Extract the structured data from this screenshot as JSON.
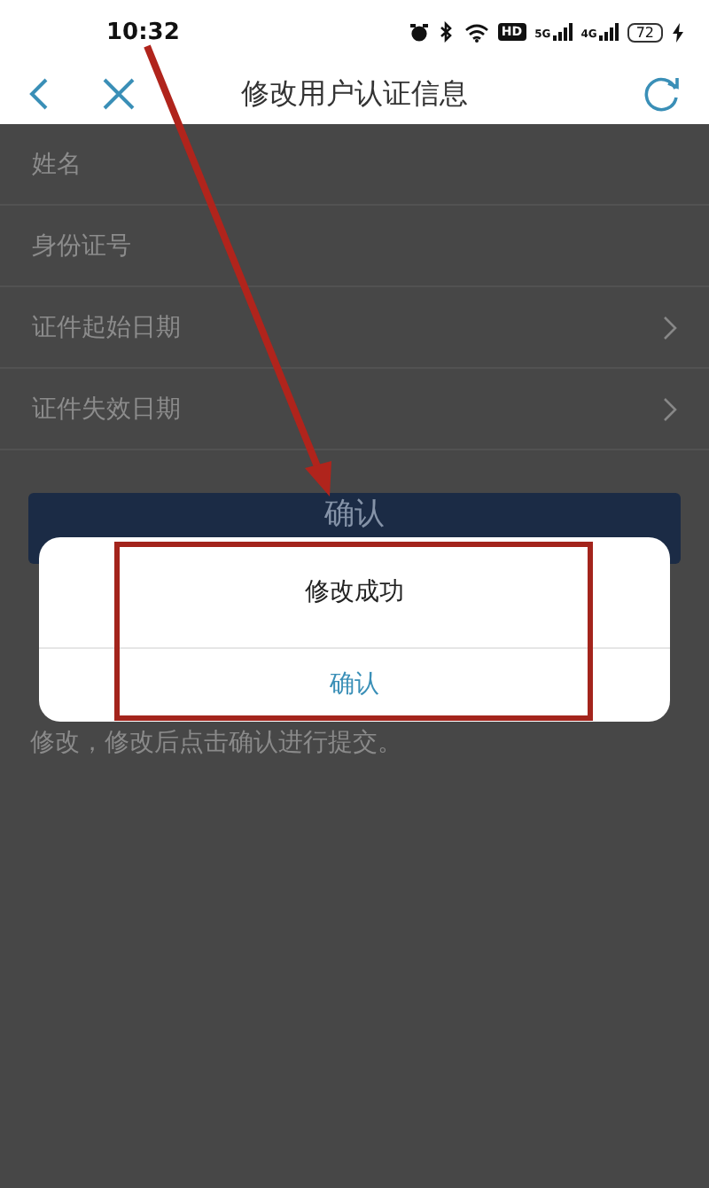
{
  "status_bar": {
    "time": "10:32",
    "hd": "HD",
    "signals": [
      "5G",
      "4G"
    ],
    "battery": "72",
    "charging": true
  },
  "nav": {
    "title": "修改用户认证信息"
  },
  "fields": [
    {
      "label": "姓名",
      "kind": "text"
    },
    {
      "label": "身份证号",
      "kind": "text"
    },
    {
      "label": "证件起始日期",
      "kind": "picker"
    },
    {
      "label": "证件失效日期",
      "kind": "picker"
    }
  ],
  "confirm_button": {
    "label": "确认"
  },
  "note": "修改，修改后点击确认进行提交。",
  "dialog": {
    "message": "修改成功",
    "button": "确认"
  }
}
